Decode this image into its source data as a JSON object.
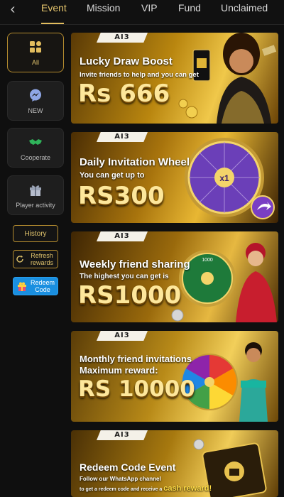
{
  "nav": {
    "tabs": [
      {
        "label": "Event",
        "active": true
      },
      {
        "label": "Mission",
        "active": false
      },
      {
        "label": "VIP",
        "active": false
      },
      {
        "label": "Fund",
        "active": false
      },
      {
        "label": "Unclaimed",
        "active": false
      }
    ],
    "back_icon": "chevron-left-icon"
  },
  "sidebar": {
    "items": [
      {
        "label": "All",
        "icon": "grid-icon",
        "active": true
      },
      {
        "label": "NEW",
        "icon": "messenger-icon",
        "active": false
      },
      {
        "label": "Cooperate",
        "icon": "handshake-icon",
        "active": false
      },
      {
        "label": "Player activity",
        "icon": "gift-icon",
        "active": false
      }
    ],
    "history_label": "History",
    "refresh_label": "Refresh rewards",
    "redeem_label": "Redeem Code"
  },
  "banners": [
    {
      "brand": "AI3",
      "title": "Lucky Draw Boost",
      "subtitle": "Invite friends to help and you can get",
      "amount": "Rs 666"
    },
    {
      "brand": "AI3",
      "title": "Daily Invitation Wheel",
      "subtitle": "You can get up to",
      "amount": "RS300",
      "wheel_center": "x1"
    },
    {
      "brand": "AI3",
      "title": "Weekly friend sharing",
      "subtitle": "The highest you can get is",
      "amount": "RS1000",
      "wheel_top": "1000"
    },
    {
      "brand": "AI3",
      "title": "Monthly friend invitations",
      "subtitle": "Maximum reward:",
      "amount": "RS 10000"
    },
    {
      "brand": "AI3",
      "title": "Redeem Code Event",
      "subtitle": "Follow our WhatsApp channel",
      "subtitle2": "to get a redeem code and receive a",
      "highlight": "cash reward!"
    }
  ],
  "colors": {
    "accent": "#e2bd5e",
    "redeem_bg": "#1a8fe0",
    "background": "#0f0f0f"
  }
}
